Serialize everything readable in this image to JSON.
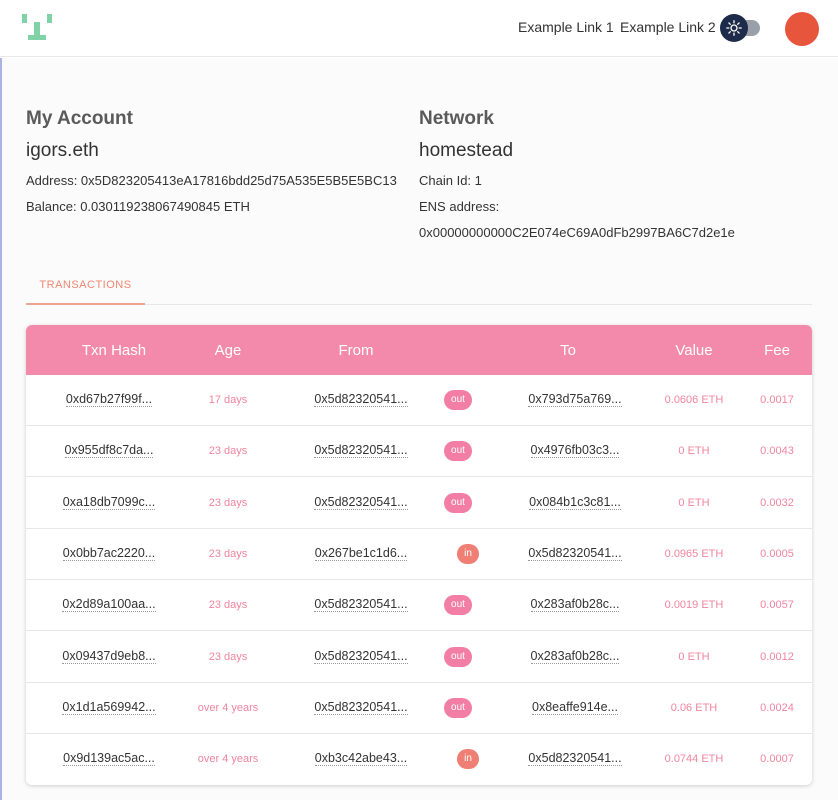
{
  "nav": {
    "links": [
      "Example Link 1",
      "Example Link 2"
    ]
  },
  "account": {
    "heading": "My Account",
    "ens": "igors.eth",
    "address": "Address: 0x5D823205413eA17816bdd25d75A535E5B5E5BC13",
    "balance": "Balance: 0.030119238067490845 ETH"
  },
  "network": {
    "heading": "Network",
    "name": "homestead",
    "chain_id": "Chain Id: 1",
    "ens_label": "ENS address:",
    "ens_address": "0x00000000000C2E074eC69A0dFb2997BA6C7d2e1e"
  },
  "tabs": {
    "transactions": "TRANSACTIONS"
  },
  "table": {
    "headers": [
      "Txn Hash",
      "Age",
      "From",
      "To",
      "Value",
      "Fee"
    ],
    "rows": [
      {
        "hash": "0xd67b27f99f...",
        "age": "17 days",
        "from": "0x5d82320541...",
        "dir": "out",
        "to": "0x793d75a769...",
        "value": "0.0606 ETH",
        "fee": "0.0017"
      },
      {
        "hash": "0x955df8c7da...",
        "age": "23 days",
        "from": "0x5d82320541...",
        "dir": "out",
        "to": "0x4976fb03c3...",
        "value": "0 ETH",
        "fee": "0.0043"
      },
      {
        "hash": "0xa18db7099c...",
        "age": "23 days",
        "from": "0x5d82320541...",
        "dir": "out",
        "to": "0x084b1c3c81...",
        "value": "0 ETH",
        "fee": "0.0032"
      },
      {
        "hash": "0x0bb7ac2220...",
        "age": "23 days",
        "from": "0x267be1c1d6...",
        "dir": "in",
        "to": "0x5d82320541...",
        "value": "0.0965 ETH",
        "fee": "0.0005"
      },
      {
        "hash": "0x2d89a100aa...",
        "age": "23 days",
        "from": "0x5d82320541...",
        "dir": "out",
        "to": "0x283af0b28c...",
        "value": "0.0019 ETH",
        "fee": "0.0057"
      },
      {
        "hash": "0x09437d9eb8...",
        "age": "23 days",
        "from": "0x5d82320541...",
        "dir": "out",
        "to": "0x283af0b28c...",
        "value": "0 ETH",
        "fee": "0.0012"
      },
      {
        "hash": "0x1d1a569942...",
        "age": "over 4 years",
        "from": "0x5d82320541...",
        "dir": "out",
        "to": "0x8eaffe914e...",
        "value": "0.06 ETH",
        "fee": "0.0024"
      },
      {
        "hash": "0x9d139ac5ac...",
        "age": "over 4 years",
        "from": "0xb3c42abe43...",
        "dir": "in",
        "to": "0x5d82320541...",
        "value": "0.0744 ETH",
        "fee": "0.0007"
      }
    ]
  },
  "colors": {
    "accent": "#f48aab",
    "avatar": "#e8553d",
    "logo": "#7fd3a6",
    "badge_out": "#f27ea5",
    "badge_in": "#ef7f74"
  },
  "icons": {
    "logo": "logo-icon",
    "theme_toggle": "sun-icon"
  }
}
